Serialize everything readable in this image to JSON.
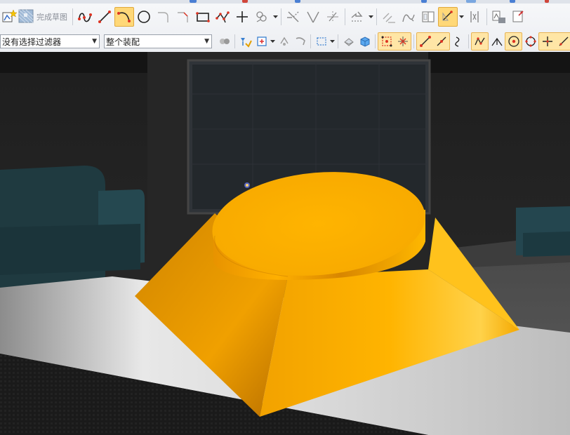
{
  "toolbar": {
    "finish_sketch_label": "完成草图",
    "selection_filter": {
      "value": "没有选择过滤器",
      "options_visible": [
        "没有选择过滤器"
      ]
    },
    "assembly_scope": {
      "value": "整个装配",
      "options_visible": [
        "整个装配"
      ]
    },
    "row1_icons": [
      "sketch-tool-icon",
      "finish-sketch-icon",
      "studio-spline-icon",
      "line-icon",
      "arc-icon",
      "circle-icon",
      "fillet-icon",
      "chamfer-icon",
      "rectangle-icon",
      "polygon-icon",
      "point-icon",
      "make-symmetric-icon",
      "quick-trim-icon",
      "quick-extend-icon",
      "make-corner-icon",
      "offset-curve-icon",
      "pattern-curve-icon",
      "mirror-curve-icon",
      "add-existing-curves-icon",
      "continuous-auto-dimension-icon",
      "geometric-constraints-icon",
      "display-constraints-icon",
      "constraint-settings-icon"
    ],
    "row2_icons": [
      "filter-settings-icon",
      "select-all-icon",
      "deselect-icon",
      "general-select-icon",
      "type-filter-icon",
      "rectangle-select-icon",
      "snap-point-icon",
      "end-point-icon",
      "mid-point-icon",
      "control-point-icon",
      "intersection-icon",
      "arc-center-icon",
      "quadrant-point-icon",
      "existing-point-icon",
      "point-on-curve-icon"
    ]
  },
  "viewport": {
    "model": "truncated-pyramid-with-cylinder-boss",
    "model_color": "#FFB000",
    "scene": "dark-living-room-backdrop"
  },
  "colors": {
    "accent_active": "#FFD878",
    "accent_border": "#E0A93D",
    "toolbar_bg": "#F1F2F5",
    "model_orange": "#FFB000"
  }
}
